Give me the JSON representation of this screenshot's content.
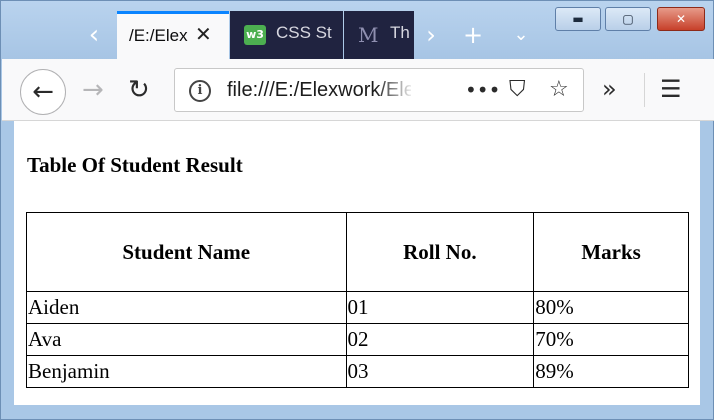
{
  "browser": {
    "tabs": [
      {
        "label": "/E:/Elex",
        "active": true
      },
      {
        "label": "CSS St",
        "icon": "w3schools-icon"
      },
      {
        "label": "Th",
        "icon": "m-icon"
      }
    ],
    "url": "file:///E:/Elexwork/Ele",
    "accent_color": "#0a84ff"
  },
  "page": {
    "title": "Table Of Student Result",
    "table": {
      "headers": [
        "Student Name",
        "Roll No.",
        "Marks"
      ],
      "rows": [
        [
          "Aiden",
          "01",
          "80%"
        ],
        [
          "Ava",
          "02",
          "70%"
        ],
        [
          "Benjamin",
          "03",
          "89%"
        ]
      ]
    }
  }
}
